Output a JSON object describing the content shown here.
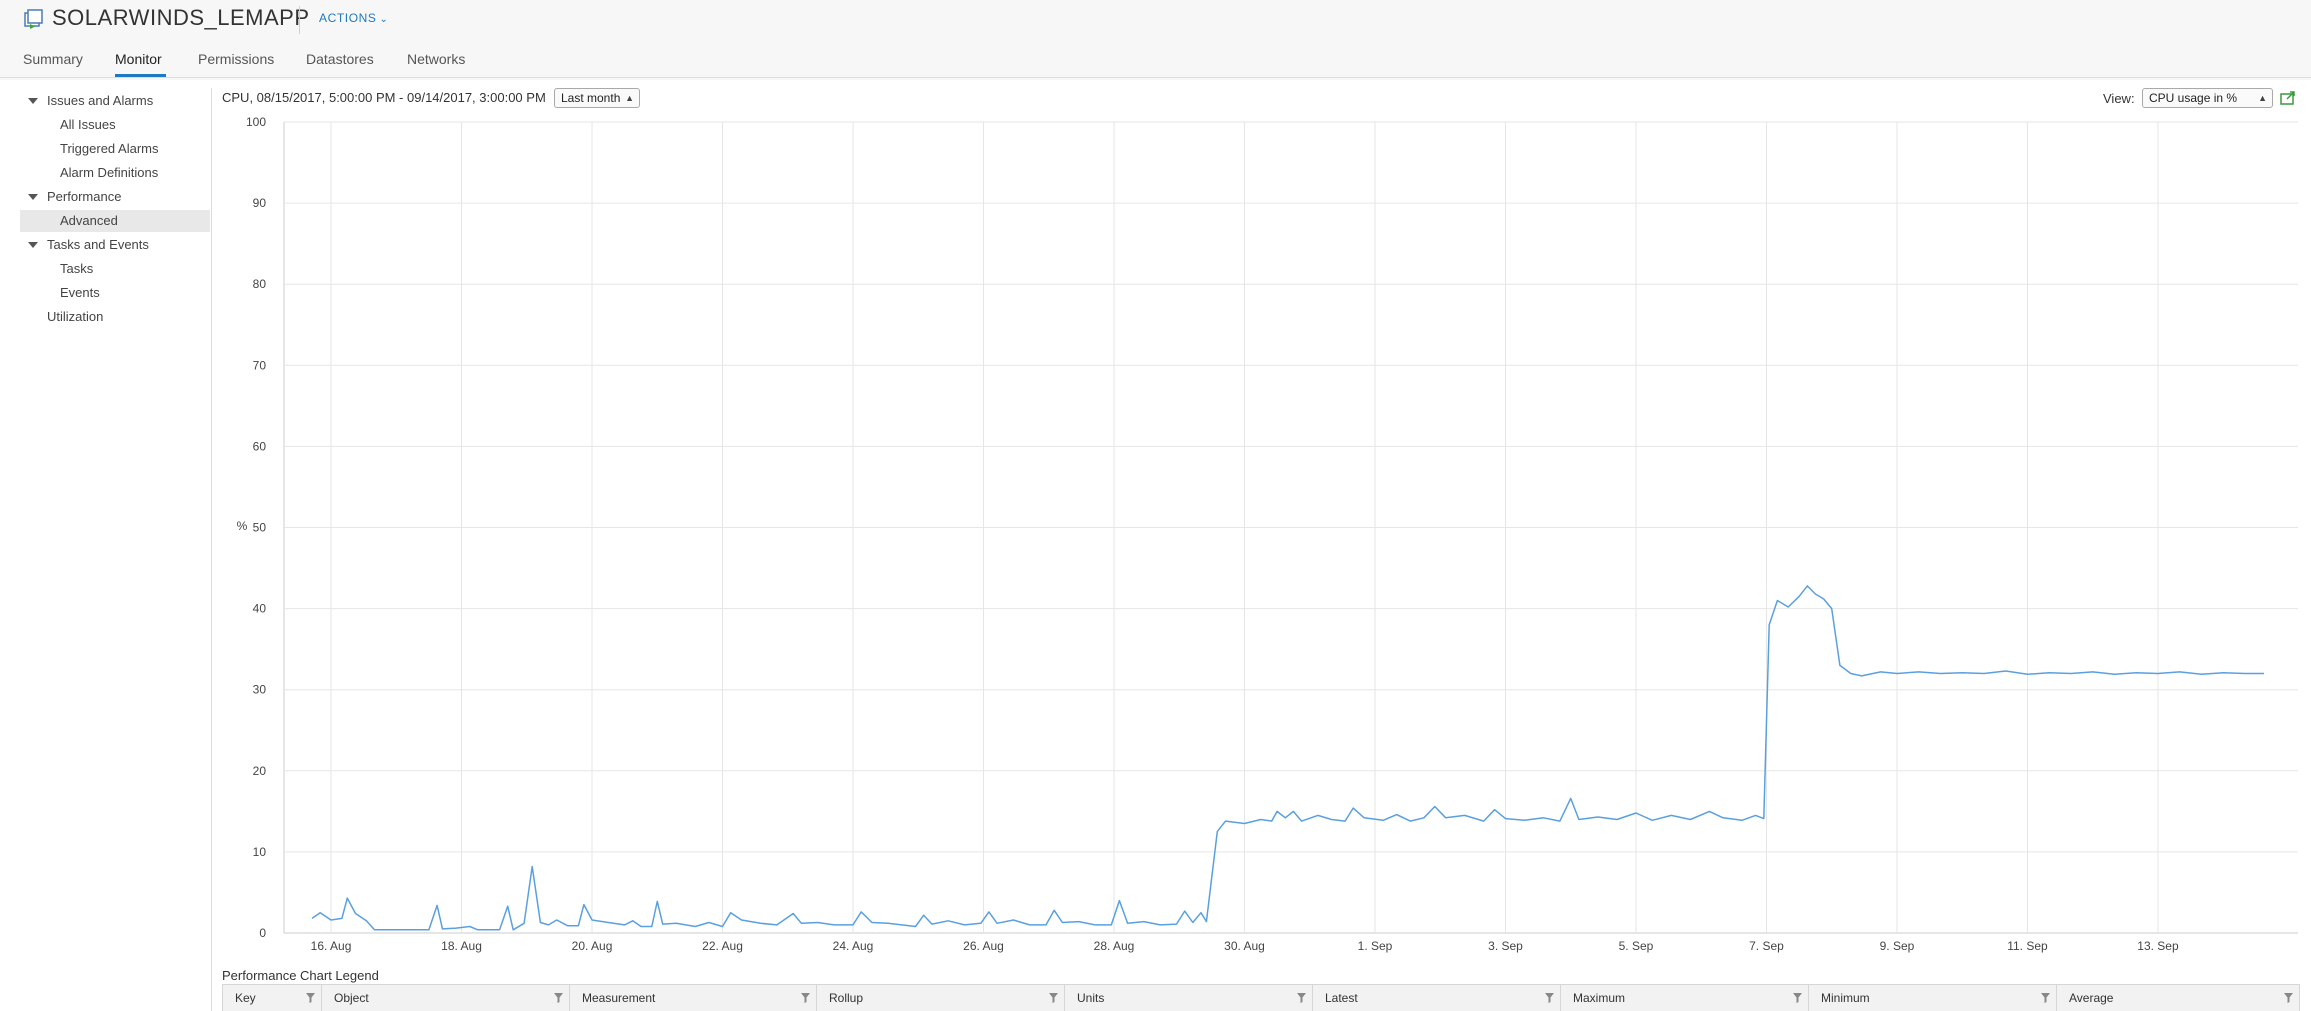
{
  "header": {
    "title": "SOLARWINDS_LEMAPP",
    "actions_label": "ACTIONS",
    "icon": "vm-icon"
  },
  "tabs": [
    {
      "label": "Summary"
    },
    {
      "label": "Monitor",
      "active": true
    },
    {
      "label": "Permissions"
    },
    {
      "label": "Datastores"
    },
    {
      "label": "Networks"
    }
  ],
  "sidebar": {
    "items": [
      {
        "label": "Issues and Alarms",
        "expanded": true
      },
      {
        "label": "All Issues"
      },
      {
        "label": "Triggered Alarms"
      },
      {
        "label": "Alarm Definitions"
      },
      {
        "label": "Performance",
        "expanded": true
      },
      {
        "label": "Advanced",
        "selected": true
      },
      {
        "label": "Tasks and Events",
        "expanded": true
      },
      {
        "label": "Tasks"
      },
      {
        "label": "Events"
      },
      {
        "label": "Utilization"
      }
    ]
  },
  "chart_header": {
    "title": "CPU, 08/15/2017, 5:00:00 PM - 09/14/2017, 3:00:00 PM",
    "period": "Last month",
    "view_label": "View:",
    "view_value": "CPU usage in %"
  },
  "legend": {
    "title": "Performance Chart Legend",
    "columns": [
      "Key",
      "Object",
      "Measurement",
      "Rollup",
      "Units",
      "Latest",
      "Maximum",
      "Minimum",
      "Average"
    ]
  },
  "colors": {
    "accent": "#1e79c2",
    "line": "#5aa0e0",
    "grid": "#e6e6e6"
  },
  "chart_data": {
    "type": "line",
    "ylabel": "%",
    "ylim": [
      0,
      100
    ],
    "yticks": [
      0,
      10,
      20,
      30,
      40,
      50,
      60,
      70,
      80,
      90,
      100
    ],
    "xlim": [
      "2017-08-15T17:00",
      "2017-09-14T15:00"
    ],
    "xticks": [
      {
        "date": "2017-08-16",
        "label": "16. Aug"
      },
      {
        "date": "2017-08-18",
        "label": "18. Aug"
      },
      {
        "date": "2017-08-20",
        "label": "20. Aug"
      },
      {
        "date": "2017-08-22",
        "label": "22. Aug"
      },
      {
        "date": "2017-08-24",
        "label": "24. Aug"
      },
      {
        "date": "2017-08-26",
        "label": "26. Aug"
      },
      {
        "date": "2017-08-28",
        "label": "28. Aug"
      },
      {
        "date": "2017-08-30",
        "label": "30. Aug"
      },
      {
        "date": "2017-09-01",
        "label": "1. Sep"
      },
      {
        "date": "2017-09-03",
        "label": "3. Sep"
      },
      {
        "date": "2017-09-05",
        "label": "5. Sep"
      },
      {
        "date": "2017-09-07",
        "label": "7. Sep"
      },
      {
        "date": "2017-09-09",
        "label": "9. Sep"
      },
      {
        "date": "2017-09-11",
        "label": "11. Sep"
      },
      {
        "date": "2017-09-13",
        "label": "13. Sep"
      }
    ],
    "grid": true,
    "series": [
      {
        "points": [
          [
            "2017-08-15T17:00",
            1.8
          ],
          [
            "2017-08-15T20:00",
            2.5
          ],
          [
            "2017-08-16T00:00",
            1.6
          ],
          [
            "2017-08-16T04:00",
            1.8
          ],
          [
            "2017-08-16T06:00",
            4.3
          ],
          [
            "2017-08-16T09:00",
            2.4
          ],
          [
            "2017-08-16T13:00",
            1.5
          ],
          [
            "2017-08-16T16:00",
            0.4
          ],
          [
            "2017-08-17T00:00",
            0.4
          ],
          [
            "2017-08-17T12:00",
            0.4
          ],
          [
            "2017-08-17T15:00",
            3.4
          ],
          [
            "2017-08-17T17:00",
            0.5
          ],
          [
            "2017-08-17T22:00",
            0.6
          ],
          [
            "2017-08-18T03:00",
            0.8
          ],
          [
            "2017-08-18T06:00",
            0.4
          ],
          [
            "2017-08-18T14:00",
            0.4
          ],
          [
            "2017-08-18T17:00",
            3.3
          ],
          [
            "2017-08-18T19:00",
            0.4
          ],
          [
            "2017-08-18T23:00",
            1.2
          ],
          [
            "2017-08-19T02:00",
            8.2
          ],
          [
            "2017-08-19T05:00",
            1.3
          ],
          [
            "2017-08-19T08:00",
            1.0
          ],
          [
            "2017-08-19T11:00",
            1.6
          ],
          [
            "2017-08-19T15:00",
            0.9
          ],
          [
            "2017-08-19T19:00",
            0.9
          ],
          [
            "2017-08-19T21:00",
            3.5
          ],
          [
            "2017-08-20T00:00",
            1.6
          ],
          [
            "2017-08-20T06:00",
            1.3
          ],
          [
            "2017-08-20T12:00",
            1.0
          ],
          [
            "2017-08-20T15:00",
            1.5
          ],
          [
            "2017-08-20T18:00",
            0.8
          ],
          [
            "2017-08-20T22:00",
            0.8
          ],
          [
            "2017-08-21T00:00",
            3.9
          ],
          [
            "2017-08-21T02:00",
            1.1
          ],
          [
            "2017-08-21T07:00",
            1.2
          ],
          [
            "2017-08-21T14:00",
            0.8
          ],
          [
            "2017-08-21T19:00",
            1.3
          ],
          [
            "2017-08-22T00:00",
            0.8
          ],
          [
            "2017-08-22T03:00",
            2.5
          ],
          [
            "2017-08-22T07:00",
            1.6
          ],
          [
            "2017-08-22T14:00",
            1.2
          ],
          [
            "2017-08-22T20:00",
            1.0
          ],
          [
            "2017-08-23T02:00",
            2.4
          ],
          [
            "2017-08-23T05:00",
            1.2
          ],
          [
            "2017-08-23T11:00",
            1.3
          ],
          [
            "2017-08-23T17:00",
            1.0
          ],
          [
            "2017-08-24T00:00",
            1.0
          ],
          [
            "2017-08-24T03:00",
            2.6
          ],
          [
            "2017-08-24T07:00",
            1.3
          ],
          [
            "2017-08-24T13:00",
            1.2
          ],
          [
            "2017-08-24T18:00",
            1.0
          ],
          [
            "2017-08-24T23:00",
            0.8
          ],
          [
            "2017-08-25T02:00",
            2.2
          ],
          [
            "2017-08-25T05:00",
            1.1
          ],
          [
            "2017-08-25T11:00",
            1.5
          ],
          [
            "2017-08-25T17:00",
            1.0
          ],
          [
            "2017-08-25T23:00",
            1.2
          ],
          [
            "2017-08-26T02:00",
            2.6
          ],
          [
            "2017-08-26T05:00",
            1.2
          ],
          [
            "2017-08-26T11:00",
            1.6
          ],
          [
            "2017-08-26T17:00",
            1.0
          ],
          [
            "2017-08-26T23:00",
            1.0
          ],
          [
            "2017-08-27T02:00",
            2.8
          ],
          [
            "2017-08-27T05:00",
            1.3
          ],
          [
            "2017-08-27T11:00",
            1.4
          ],
          [
            "2017-08-27T17:00",
            1.0
          ],
          [
            "2017-08-27T23:00",
            1.0
          ],
          [
            "2017-08-28T02:00",
            4.0
          ],
          [
            "2017-08-28T05:00",
            1.2
          ],
          [
            "2017-08-28T11:00",
            1.4
          ],
          [
            "2017-08-28T17:00",
            1.0
          ],
          [
            "2017-08-28T23:00",
            1.1
          ],
          [
            "2017-08-29T02:00",
            2.7
          ],
          [
            "2017-08-29T05:00",
            1.3
          ],
          [
            "2017-08-29T08:00",
            2.5
          ],
          [
            "2017-08-29T10:00",
            1.4
          ],
          [
            "2017-08-29T14:00",
            12.5
          ],
          [
            "2017-08-29T17:00",
            13.8
          ],
          [
            "2017-08-30T00:00",
            13.5
          ],
          [
            "2017-08-30T06:00",
            14.0
          ],
          [
            "2017-08-30T10:00",
            13.8
          ],
          [
            "2017-08-30T12:00",
            15.0
          ],
          [
            "2017-08-30T15:00",
            14.2
          ],
          [
            "2017-08-30T18:00",
            15.0
          ],
          [
            "2017-08-30T21:00",
            13.8
          ],
          [
            "2017-08-31T03:00",
            14.5
          ],
          [
            "2017-08-31T08:00",
            14.0
          ],
          [
            "2017-08-31T13:00",
            13.8
          ],
          [
            "2017-08-31T16:00",
            15.4
          ],
          [
            "2017-08-31T20:00",
            14.2
          ],
          [
            "2017-09-01T03:00",
            13.9
          ],
          [
            "2017-09-01T08:00",
            14.6
          ],
          [
            "2017-09-01T13:00",
            13.8
          ],
          [
            "2017-09-01T18:00",
            14.2
          ],
          [
            "2017-09-01T22:00",
            15.6
          ],
          [
            "2017-09-02T02:00",
            14.2
          ],
          [
            "2017-09-02T09:00",
            14.5
          ],
          [
            "2017-09-02T16:00",
            13.8
          ],
          [
            "2017-09-02T20:00",
            15.2
          ],
          [
            "2017-09-03T00:00",
            14.1
          ],
          [
            "2017-09-03T07:00",
            13.9
          ],
          [
            "2017-09-03T14:00",
            14.2
          ],
          [
            "2017-09-03T20:00",
            13.8
          ],
          [
            "2017-09-04T00:00",
            16.6
          ],
          [
            "2017-09-04T03:00",
            14.0
          ],
          [
            "2017-09-04T10:00",
            14.3
          ],
          [
            "2017-09-04T17:00",
            14.0
          ],
          [
            "2017-09-05T00:00",
            14.8
          ],
          [
            "2017-09-05T06:00",
            13.9
          ],
          [
            "2017-09-05T13:00",
            14.5
          ],
          [
            "2017-09-05T20:00",
            14.0
          ],
          [
            "2017-09-06T03:00",
            15.0
          ],
          [
            "2017-09-06T08:00",
            14.2
          ],
          [
            "2017-09-06T15:00",
            13.9
          ],
          [
            "2017-09-06T20:00",
            14.5
          ],
          [
            "2017-09-06T23:00",
            14.1
          ],
          [
            "2017-09-07T01:00",
            38.0
          ],
          [
            "2017-09-07T04:00",
            41.0
          ],
          [
            "2017-09-07T08:00",
            40.2
          ],
          [
            "2017-09-07T12:00",
            41.5
          ],
          [
            "2017-09-07T15:00",
            42.8
          ],
          [
            "2017-09-07T18:00",
            41.8
          ],
          [
            "2017-09-07T21:00",
            41.2
          ],
          [
            "2017-09-08T00:00",
            40.0
          ],
          [
            "2017-09-08T03:00",
            33.0
          ],
          [
            "2017-09-08T07:00",
            32.0
          ],
          [
            "2017-09-08T11:00",
            31.7
          ],
          [
            "2017-09-08T18:00",
            32.2
          ],
          [
            "2017-09-09T00:00",
            32.0
          ],
          [
            "2017-09-09T08:00",
            32.2
          ],
          [
            "2017-09-09T16:00",
            32.0
          ],
          [
            "2017-09-10T00:00",
            32.1
          ],
          [
            "2017-09-10T08:00",
            32.0
          ],
          [
            "2017-09-10T16:00",
            32.3
          ],
          [
            "2017-09-11T00:00",
            31.9
          ],
          [
            "2017-09-11T08:00",
            32.1
          ],
          [
            "2017-09-11T16:00",
            32.0
          ],
          [
            "2017-09-12T00:00",
            32.2
          ],
          [
            "2017-09-12T08:00",
            31.9
          ],
          [
            "2017-09-12T16:00",
            32.1
          ],
          [
            "2017-09-13T00:00",
            32.0
          ],
          [
            "2017-09-13T08:00",
            32.2
          ],
          [
            "2017-09-13T16:00",
            31.9
          ],
          [
            "2017-09-14T00:00",
            32.1
          ],
          [
            "2017-09-14T08:00",
            32.0
          ],
          [
            "2017-09-14T15:00",
            32.0
          ]
        ]
      }
    ]
  }
}
